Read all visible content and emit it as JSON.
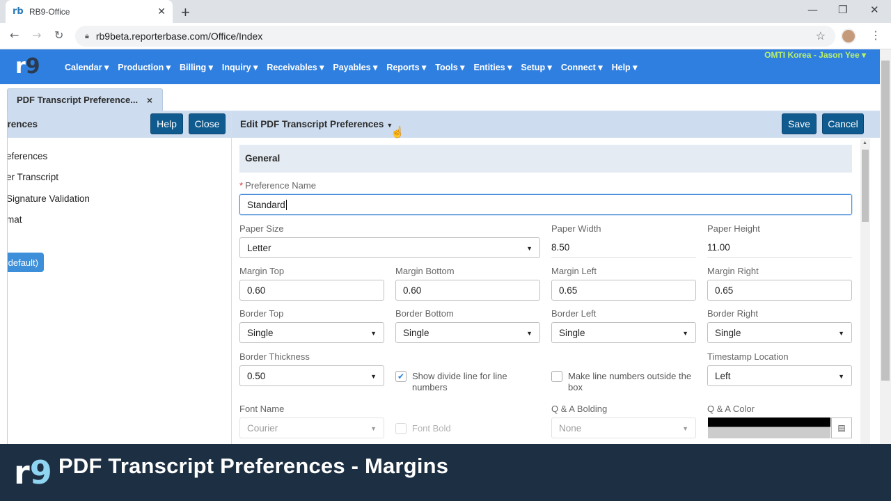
{
  "browser": {
    "tab_title": "RB9-Office",
    "favicon": "rb",
    "url": "rb9beta.reporterbase.com/Office/Index"
  },
  "app": {
    "menu": [
      "Calendar ▾",
      "Production ▾",
      "Billing ▾",
      "Inquiry ▾",
      "Receivables ▾",
      "Payables ▾",
      "Reports ▾",
      "Tools ▾",
      "Entities ▾",
      "Setup ▾",
      "Connect ▾",
      "Help ▾"
    ],
    "user": "OMTI Korea - Jason Yee ▾",
    "doc_tab": "PDF Transcript Preference...",
    "doc_tab_close": "×"
  },
  "left": {
    "title": "erences",
    "help_label": "Help",
    "close_label": "Close",
    "items": [
      "eferences",
      "er Transcript",
      "Signature Validation",
      "mat"
    ],
    "default_label": "default)"
  },
  "editor": {
    "title": "Edit PDF Transcript Preferences",
    "save_label": "Save",
    "cancel_label": "Cancel",
    "section": "General",
    "preference_name_label": "Preference Name",
    "preference_name_value": "Standard",
    "paper_size_label": "Paper Size",
    "paper_size_value": "Letter",
    "paper_width_label": "Paper Width",
    "paper_width_value": "8.50",
    "paper_height_label": "Paper Height",
    "paper_height_value": "11.00",
    "margin_top_label": "Margin Top",
    "margin_top_value": "0.60",
    "margin_bottom_label": "Margin Bottom",
    "margin_bottom_value": "0.60",
    "margin_left_label": "Margin Left",
    "margin_left_value": "0.65",
    "margin_right_label": "Margin Right",
    "margin_right_value": "0.65",
    "border_top_label": "Border Top",
    "border_top_value": "Single",
    "border_bottom_label": "Border Bottom",
    "border_bottom_value": "Single",
    "border_left_label": "Border Left",
    "border_left_value": "Single",
    "border_right_label": "Border Right",
    "border_right_value": "Single",
    "border_thickness_label": "Border Thickness",
    "border_thickness_value": "0.50",
    "show_divide_label": "Show divide line for line numbers",
    "show_divide_checked": true,
    "outside_numbers_label": "Make line numbers outside the box",
    "outside_numbers_checked": false,
    "timestamp_label": "Timestamp Location",
    "timestamp_value": "Left",
    "font_name_label": "Font Name",
    "font_name_value": "Courier",
    "font_bold_label": "Font Bold",
    "qa_bolding_label": "Q & A Bolding",
    "qa_bolding_value": "None",
    "qa_color_label": "Q & A Color"
  },
  "banner": {
    "logo": "rb9",
    "title": "PDF Transcript Preferences - Margins"
  }
}
